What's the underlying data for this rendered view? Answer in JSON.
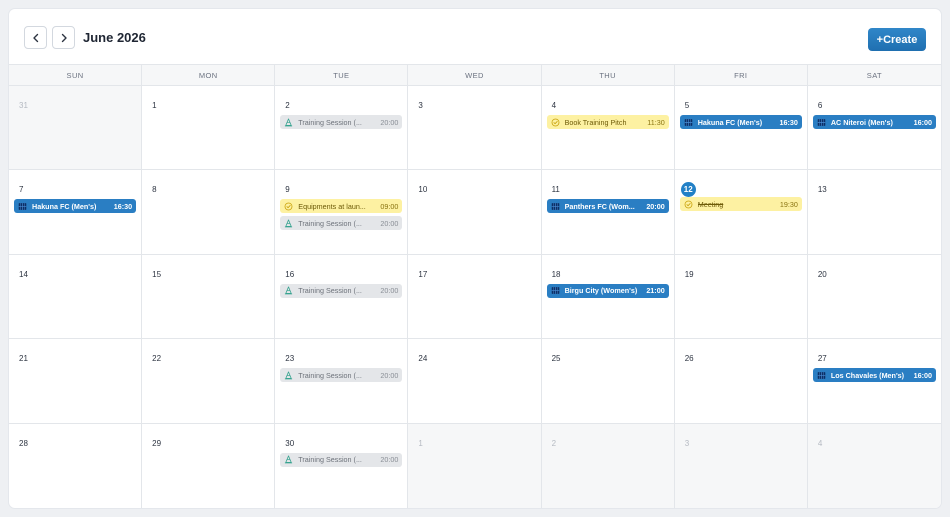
{
  "header": {
    "prev_icon": "chevron-left-icon",
    "next_icon": "chevron-right-icon",
    "month_title": "June 2026",
    "create_label": "+Create"
  },
  "colors": {
    "accent": "#2280c6",
    "match_event": "#2a7ec3",
    "training_event": "#e4e6e9",
    "task_event": "#fdf1a2"
  },
  "weekdays": [
    "SUN",
    "MON",
    "TUE",
    "WED",
    "THU",
    "FRI",
    "SAT"
  ],
  "weeks": [
    [
      {
        "day": "31",
        "other": true,
        "events": []
      },
      {
        "day": "1",
        "events": []
      },
      {
        "day": "2",
        "events": [
          {
            "type": "training",
            "icon": "cone-icon",
            "title": "Training Session (...",
            "time": "20:00"
          }
        ]
      },
      {
        "day": "3",
        "events": []
      },
      {
        "day": "4",
        "events": [
          {
            "type": "task",
            "icon": "check-circle-icon",
            "title": "Book Training Pitch",
            "time": "11:30"
          }
        ]
      },
      {
        "day": "5",
        "events": [
          {
            "type": "match",
            "icon": "pitch-icon",
            "title": "Hakuna FC (Men's)",
            "time": "16:30"
          }
        ]
      },
      {
        "day": "6",
        "events": [
          {
            "type": "match",
            "icon": "pitch-icon",
            "title": "AC Niteroi (Men's)",
            "time": "16:00"
          }
        ]
      }
    ],
    [
      {
        "day": "7",
        "events": [
          {
            "type": "match",
            "icon": "pitch-icon",
            "title": "Hakuna FC (Men's)",
            "time": "16:30"
          }
        ]
      },
      {
        "day": "8",
        "events": []
      },
      {
        "day": "9",
        "events": [
          {
            "type": "task",
            "icon": "check-circle-icon",
            "title": "Equipments at laun...",
            "time": "09:00"
          },
          {
            "type": "training",
            "icon": "cone-icon",
            "title": "Training Session (...",
            "time": "20:00"
          }
        ]
      },
      {
        "day": "10",
        "events": []
      },
      {
        "day": "11",
        "events": [
          {
            "type": "match",
            "icon": "pitch-icon",
            "title": "Panthers FC (Wom...",
            "time": "20:00"
          }
        ]
      },
      {
        "day": "12",
        "today": true,
        "events": [
          {
            "type": "task",
            "done": true,
            "icon": "check-circle-icon",
            "title": "Meeting",
            "time": "19:30"
          }
        ]
      },
      {
        "day": "13",
        "events": []
      }
    ],
    [
      {
        "day": "14",
        "events": []
      },
      {
        "day": "15",
        "events": []
      },
      {
        "day": "16",
        "events": [
          {
            "type": "training",
            "icon": "cone-icon",
            "title": "Training Session (...",
            "time": "20:00"
          }
        ]
      },
      {
        "day": "17",
        "events": []
      },
      {
        "day": "18",
        "events": [
          {
            "type": "match",
            "icon": "pitch-icon",
            "title": "Birgu City (Women's)",
            "time": "21:00"
          }
        ]
      },
      {
        "day": "19",
        "events": []
      },
      {
        "day": "20",
        "events": []
      }
    ],
    [
      {
        "day": "21",
        "events": []
      },
      {
        "day": "22",
        "events": []
      },
      {
        "day": "23",
        "events": [
          {
            "type": "training",
            "icon": "cone-icon",
            "title": "Training Session (...",
            "time": "20:00"
          }
        ]
      },
      {
        "day": "24",
        "events": []
      },
      {
        "day": "25",
        "events": []
      },
      {
        "day": "26",
        "events": []
      },
      {
        "day": "27",
        "events": [
          {
            "type": "match",
            "icon": "pitch-icon",
            "title": "Los Chavales (Men's)",
            "time": "16:00"
          }
        ]
      }
    ],
    [
      {
        "day": "28",
        "events": []
      },
      {
        "day": "29",
        "events": []
      },
      {
        "day": "30",
        "events": [
          {
            "type": "training",
            "icon": "cone-icon",
            "title": "Training Session (...",
            "time": "20:00"
          }
        ]
      },
      {
        "day": "1",
        "other": true,
        "events": []
      },
      {
        "day": "2",
        "other": true,
        "events": []
      },
      {
        "day": "3",
        "other": true,
        "events": []
      },
      {
        "day": "4",
        "other": true,
        "events": []
      }
    ]
  ]
}
